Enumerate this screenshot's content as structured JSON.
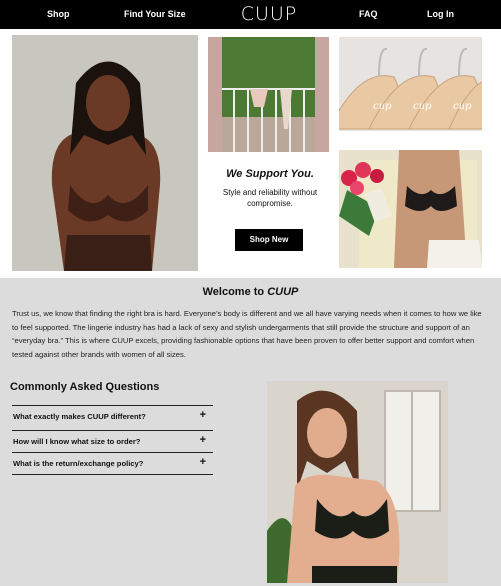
{
  "nav": {
    "shop": "Shop",
    "find_size": "Find Your Size",
    "logo": "CUUP",
    "faq": "FAQ",
    "login": "Log In"
  },
  "hero": {
    "support_title": "We Support You.",
    "support_sub": "Style and reliability without compromise.",
    "shop_new": "Shop New",
    "hanger_logo": "cup"
  },
  "welcome": {
    "prefix": "Welcome to",
    "brand": "CUUP",
    "intro": "Trust us, we know that finding the right bra is hard. Everyone’s body is different and we all have varying needs when it comes to how we like to feel supported.  The lingerie industry has had a lack of sexy and stylish undergarments that still provide the structure and support of an “everyday bra.” This is where CUUP excels, providing fashionable options that have been proven to offer better support and comfort when tested against other brands with women of all sizes."
  },
  "faq": {
    "title": "Commonly Asked Questions",
    "items": [
      {
        "q": "What exactly makes CUUP different?",
        "icon": "+"
      },
      {
        "q": "How will I know what size to order?",
        "icon": "+"
      },
      {
        "q": "What is the return/exchange policy?",
        "icon": "+"
      }
    ]
  }
}
